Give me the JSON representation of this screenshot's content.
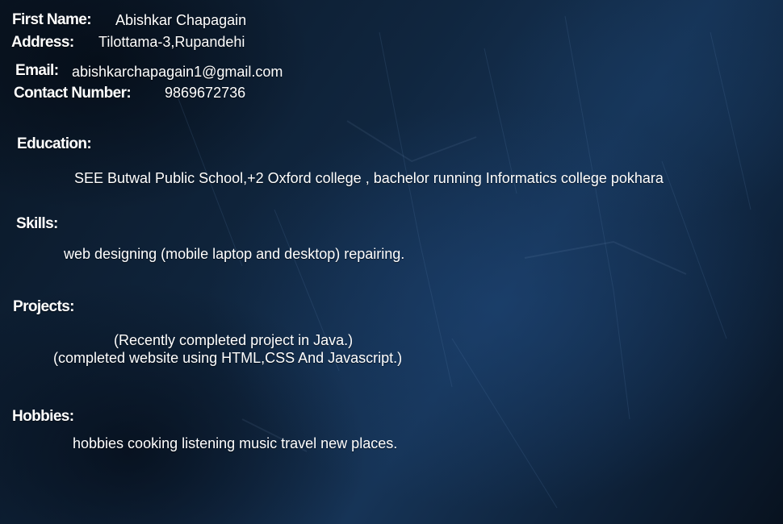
{
  "profile": {
    "first_name_label": "First Name:",
    "first_name": "Abishkar Chapagain",
    "address_label": "Address:",
    "address": "Tilottama-3,Rupandehi",
    "email_label": "Email:",
    "email": "abishkarchapagain1@gmail.com",
    "contact_label": "Contact Number:",
    "contact": "9869672736"
  },
  "education": {
    "label": "Education:",
    "text": "SEE Butwal Public School,+2 Oxford college , bachelor running Informatics college pokhara"
  },
  "skills": {
    "label": "Skills:",
    "text": "web designing (mobile laptop and desktop) repairing."
  },
  "projects": {
    "label": "Projects:",
    "items": [
      "(Recently completed project in Java.)",
      "(completed website using HTML,CSS And Javascript.)"
    ]
  },
  "hobbies": {
    "label": "Hobbies:",
    "text": "hobbies cooking listening music travel new places."
  },
  "colors": {
    "text": "#ffffff",
    "background_dark": "#0b1a2c",
    "background_highlight": "#163457"
  }
}
